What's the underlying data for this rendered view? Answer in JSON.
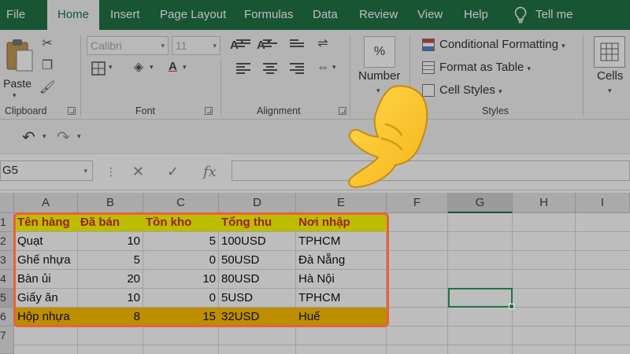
{
  "tabs": [
    {
      "label": "File",
      "active": false
    },
    {
      "label": "Home",
      "active": true
    },
    {
      "label": "Insert",
      "active": false
    },
    {
      "label": "Page Layout",
      "active": false
    },
    {
      "label": "Formulas",
      "active": false
    },
    {
      "label": "Data",
      "active": false
    },
    {
      "label": "Review",
      "active": false
    },
    {
      "label": "View",
      "active": false
    },
    {
      "label": "Help",
      "active": false
    }
  ],
  "tell_me": "Tell me",
  "ribbon": {
    "clipboard": {
      "paste_label": "Paste",
      "group_label": "Clipboard"
    },
    "font": {
      "font_name": "Calibri",
      "font_size": "11",
      "group_label": "Font"
    },
    "alignment": {
      "group_label": "Alignment"
    },
    "number": {
      "label": "Number",
      "icon_glyph": "%"
    },
    "styles": {
      "conditional_formatting": "Conditional Formatting",
      "format_as_table": "Format as Table",
      "cell_styles": "Cell Styles",
      "group_label": "Styles"
    },
    "cells": {
      "label": "Cells"
    }
  },
  "formula_bar": {
    "name_box": "G5",
    "fx": "fx"
  },
  "grid": {
    "columns": [
      "A",
      "B",
      "C",
      "D",
      "E",
      "F",
      "G",
      "H",
      "I"
    ],
    "rows": [
      "1",
      "2",
      "3",
      "4",
      "5",
      "6",
      "7"
    ],
    "table": {
      "headers": [
        "Tên hàng",
        "Đã bán",
        "Tồn kho",
        "Tổng thu",
        "Nơi nhập"
      ],
      "data": [
        [
          "Quạt",
          "10",
          "5",
          "100USD",
          "TPHCM"
        ],
        [
          "Ghế nhựa",
          "5",
          "0",
          "50USD",
          "Đà Nẵng"
        ],
        [
          "Bàn ủi",
          "20",
          "10",
          "80USD",
          "Hà Nội"
        ],
        [
          "Giấy ăn",
          "10",
          "0",
          "5USD",
          "TPHCM"
        ],
        [
          "Hộp nhựa",
          "8",
          "15",
          "32USD",
          "Huế"
        ]
      ]
    },
    "selected_cell": "G5"
  },
  "colors": {
    "accent": "#217346",
    "header_fill": "#ffff00",
    "header_text": "#d02c2c",
    "highlight_row": "#ffc000",
    "table_outline": "#e8613c"
  }
}
